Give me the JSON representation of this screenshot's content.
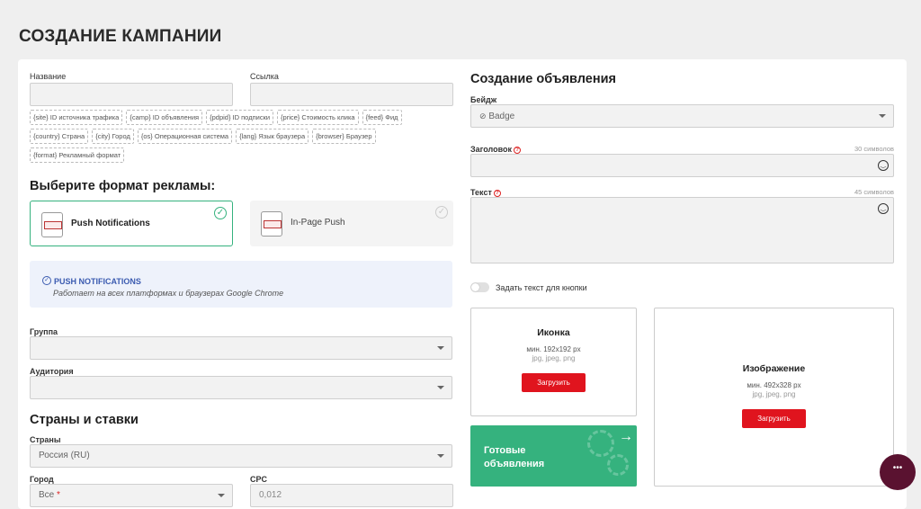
{
  "page": {
    "title": "СОЗДАНИЕ КАМПАНИИ"
  },
  "left": {
    "name_label": "Название",
    "link_label": "Ссылка",
    "macros": [
      "{site} ID источника трафика",
      "{camp} ID объявления",
      "{pdpid} ID подписки",
      "{price} Стоимость клика",
      "{feed} Фид",
      "{country} Страна",
      "{city} Город",
      "{os} Операционная система",
      "{lang} Язык браузера",
      "{browser} Браузер",
      "{format} Рекламный формат"
    ],
    "format_heading": "Выберите формат рекламы:",
    "formats": [
      {
        "label": "Push Notifications",
        "selected": true
      },
      {
        "label": "In-Page Push",
        "selected": false
      }
    ],
    "info": {
      "title": "PUSH NOTIFICATIONS",
      "text": "Работает на всех платформах и браузерах Google Chrome"
    },
    "group_label": "Группа",
    "audience_label": "Аудитория",
    "countries_heading": "Страны и ставки",
    "countries_label": "Страны",
    "countries_value": "Россия (RU)",
    "city_label": "Город",
    "city_value": "Все",
    "cpc_label": "CPC",
    "cpc_value": "0,012"
  },
  "right": {
    "heading": "Создание объявления",
    "badge_label": "Бейдж",
    "badge_value": "Badge",
    "title_label": "Заголовок",
    "title_count": "30 символов",
    "text_label": "Текст",
    "text_count": "45 символов",
    "toggle_label": "Задать текст для кнопки",
    "icon_box": {
      "title": "Иконка",
      "size": "мин. 192x192 px",
      "formats": "jpg, jpeg, png",
      "button": "Загрузить"
    },
    "image_box": {
      "title": "Изображение",
      "size": "мин. 492x328 px",
      "formats": "jpg, jpeg, png",
      "button": "Загрузить"
    },
    "ready": {
      "title": "Готовые объявления",
      "arrow": "→"
    }
  },
  "colors": {
    "accent_red": "#e0141e",
    "green": "#35b27e",
    "info_blue": "#3b5bb0",
    "chat": "#5a1230"
  }
}
